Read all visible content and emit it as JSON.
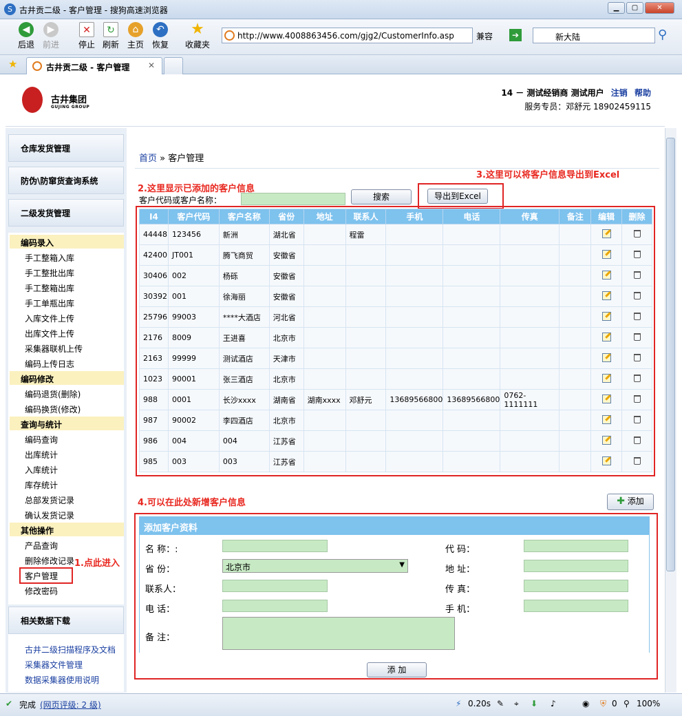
{
  "window": {
    "title": "古井贡二级 - 客户管理 - 搜狗高速浏览器"
  },
  "toolbar": {
    "back": "后退",
    "forward": "前进",
    "stop": "停止",
    "refresh": "刷新",
    "home": "主页",
    "restore": "恢复",
    "favorites": "收藏夹",
    "url": "http://www.4008863456.com/gjg2/CustomerInfo.asp",
    "compat": "兼容",
    "search_value": "新大陆"
  },
  "tabs": [
    {
      "label": "古井贡二级 - 客户管理"
    }
  ],
  "header": {
    "logo_cn": "古井集团",
    "logo_en": "GUJING GROUP",
    "user_info": "14 － 测试经销商 测试用户",
    "logout": "注销",
    "help": "帮助",
    "service": "服务专员：邓舒元 18902459115"
  },
  "sidebar": {
    "sections": [
      {
        "label": "仓库发货管理"
      },
      {
        "label": "防伪\\防窜货查询系统"
      },
      {
        "label": "二级发货管理"
      }
    ],
    "groups": [
      {
        "label": "编码录入",
        "items": [
          "手工整箱入库",
          "手工整批出库",
          "手工整箱出库",
          "手工单瓶出库",
          "入库文件上传",
          "出库文件上传",
          "采集器联机上传",
          "编码上传日志"
        ]
      },
      {
        "label": "编码修改",
        "items": [
          "编码退货(删除)",
          "编码换货(修改)"
        ]
      },
      {
        "label": "查询与统计",
        "items": [
          "编码查询",
          "出库统计",
          "入库统计",
          "库存统计",
          "总部发货记录",
          "确认发货记录"
        ]
      },
      {
        "label": "其他操作",
        "items": [
          "产品查询",
          "删除修改记录",
          "客户管理",
          "修改密码"
        ]
      }
    ],
    "download_title": "相关数据下载",
    "downloads": [
      "古井二级扫描程序及文档",
      "采集器文件管理",
      "数据采集器使用说明"
    ]
  },
  "main": {
    "breadcrumb_home": "首页",
    "breadcrumb_sep": "»",
    "breadcrumb_current": "客户管理",
    "annot1": "1.点此进入",
    "annot2": "2.这里显示已添加的客户信息",
    "annot3": "3.这里可以将客户信息导出到Excel",
    "annot4": "4.可以在此处新增客户信息",
    "search_label": "客户代码或客户名称：",
    "search_button": "搜索",
    "export_button": "导出到Excel",
    "columns": [
      "I4",
      "客户代码",
      "客户名称",
      "省份",
      "地址",
      "联系人",
      "手机",
      "电话",
      "传真",
      "备注",
      "编辑",
      "删除"
    ],
    "rows": [
      [
        "44448",
        "123456",
        "新洲",
        "湖北省",
        "",
        "程雷",
        "",
        "",
        "",
        ""
      ],
      [
        "42400",
        "JT001",
        "腾飞商贸",
        "安徽省",
        "",
        "",
        "",
        "",
        "",
        ""
      ],
      [
        "30406",
        "002",
        "杨砾",
        "安徽省",
        "",
        "",
        "",
        "",
        "",
        ""
      ],
      [
        "30392",
        "001",
        "徐海丽",
        "安徽省",
        "",
        "",
        "",
        "",
        "",
        ""
      ],
      [
        "25796",
        "99003",
        "****大酒店",
        "河北省",
        "",
        "",
        "",
        "",
        "",
        ""
      ],
      [
        "2176",
        "8009",
        "王进喜",
        "北京市",
        "",
        "",
        "",
        "",
        "",
        ""
      ],
      [
        "2163",
        "99999",
        "测试酒店",
        "天津市",
        "",
        "",
        "",
        "",
        "",
        ""
      ],
      [
        "1023",
        "90001",
        "张三酒店",
        "北京市",
        "",
        "",
        "",
        "",
        "",
        ""
      ],
      [
        "988",
        "0001",
        "长沙xxxx",
        "湖南省",
        "湖南xxxx",
        "邓舒元",
        "13689566800",
        "13689566800",
        "0762-1111111",
        ""
      ],
      [
        "987",
        "90002",
        "李四酒店",
        "北京市",
        "",
        "",
        "",
        "",
        "",
        ""
      ],
      [
        "986",
        "004",
        "004",
        "江苏省",
        "",
        "",
        "",
        "",
        "",
        ""
      ],
      [
        "985",
        "003",
        "003",
        "江苏省",
        "",
        "",
        "",
        "",
        "",
        ""
      ]
    ],
    "add_button": "添加",
    "form": {
      "title": "添加客户资料",
      "name_label": "名 称：:",
      "code_label": "代 码：",
      "province_label": "省 份：",
      "province_value": "北京市",
      "address_label": "地 址：",
      "contact_label": "联系人：",
      "fax_label": "传 真：",
      "phone_label": "电 话：",
      "mobile_label": "手 机：",
      "remark_label": "备 注：",
      "submit": "添 加"
    }
  },
  "status": {
    "done": "完成",
    "rating": "(网页评级: 2 级)",
    "time": "0.20s",
    "count": "0",
    "zoom": "100%"
  },
  "colors": {
    "table_header": "#7ec2ee",
    "input_bg": "#c7eac4",
    "annotation": "#e8271f",
    "link": "#1a3fa0"
  }
}
